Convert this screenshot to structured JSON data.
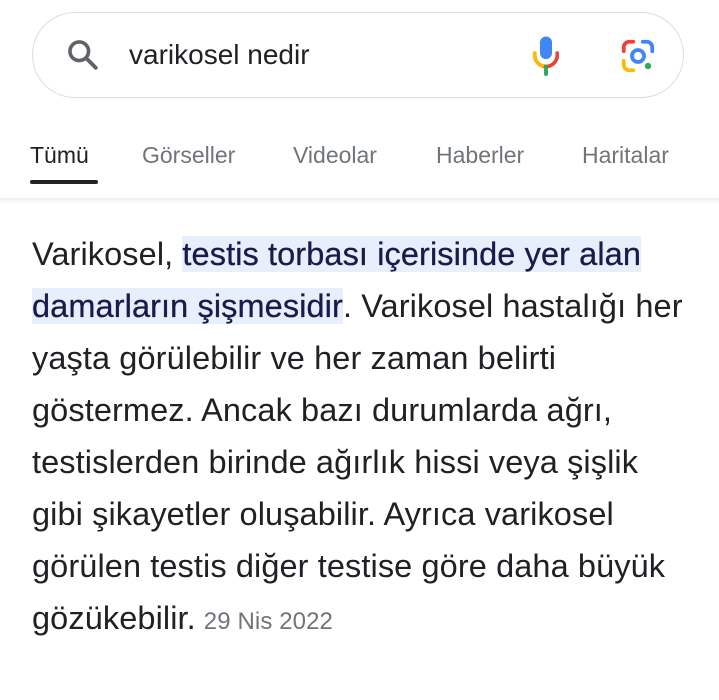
{
  "search": {
    "query": "varikosel nedir",
    "icons": {
      "search": "search-icon",
      "mic": "microphone-icon",
      "lens": "google-lens-icon"
    }
  },
  "tabs": [
    {
      "label": "Tümü",
      "active": true
    },
    {
      "label": "Görseller",
      "active": false
    },
    {
      "label": "Videolar",
      "active": false
    },
    {
      "label": "Haberler",
      "active": false
    },
    {
      "label": "Haritalar",
      "active": false
    }
  ],
  "snippet": {
    "lead": "Varikosel, ",
    "highlight": "testis torbası içerisinde yer alan damarların şişmesidir",
    "body": ". Varikosel hastalığı her yaşta görülebilir ve her zaman belirti göstermez. Ancak bazı durumlarda ağrı, testislerden birinde ağırlık hissi veya şişlik gibi şikayetler oluşabilir. Ayrıca varikosel görülen testis diğer testise göre daha büyük gözükebilir.",
    "date": "29 Nis 2022"
  },
  "colors": {
    "highlight_bg": "#e8effc",
    "highlight_text": "#171c4a",
    "muted": "#70757a",
    "text": "#202124"
  }
}
